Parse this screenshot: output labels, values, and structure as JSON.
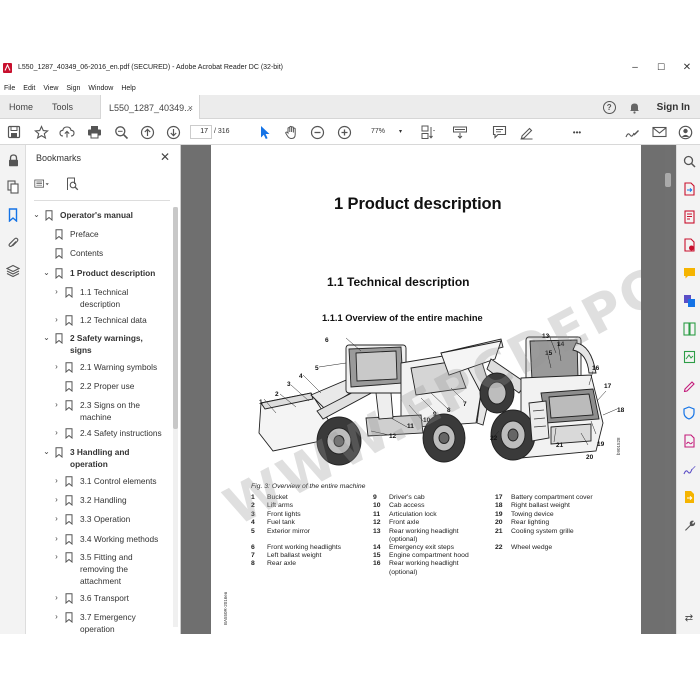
{
  "window": {
    "title": "L550_1287_40349_06-2016_en.pdf (SECURED) - Adobe Acrobat Reader DC (32-bit)",
    "minimize": "–",
    "maximize": "☐",
    "close": "✕"
  },
  "menu": [
    "File",
    "Edit",
    "View",
    "Sign",
    "Window",
    "Help"
  ],
  "tabs": {
    "home": "Home",
    "tools": "Tools",
    "doc": "L550_1287_40349...",
    "doc_close": "×",
    "signin": "Sign In",
    "help": "?"
  },
  "toolbar": {
    "page_current": "17",
    "page_total": "/ 316",
    "zoom": "77%",
    "zoom_caret": "▾",
    "more": "•••"
  },
  "bookmarks": {
    "header": "Bookmarks",
    "close": "✕",
    "items": [
      {
        "label": "Operator's manual",
        "level": 0,
        "chev": "⌄",
        "bold": true
      },
      {
        "label": "Preface",
        "level": 1,
        "chev": "",
        "bold": false
      },
      {
        "label": "Contents",
        "level": 1,
        "chev": "",
        "bold": false
      },
      {
        "label": "1 Product description",
        "level": 1,
        "chev": "⌄",
        "bold": true
      },
      {
        "label": "1.1 Technical description",
        "level": 2,
        "chev": "›",
        "bold": false
      },
      {
        "label": "1.2 Technical data",
        "level": 2,
        "chev": "›",
        "bold": false
      },
      {
        "label": "2 Safety warnings, signs",
        "level": 1,
        "chev": "⌄",
        "bold": true
      },
      {
        "label": "2.1 Warning symbols",
        "level": 2,
        "chev": "›",
        "bold": false
      },
      {
        "label": "2.2 Proper use",
        "level": 2,
        "chev": "",
        "bold": false
      },
      {
        "label": "2.3 Signs on the machine",
        "level": 2,
        "chev": "›",
        "bold": false
      },
      {
        "label": "2.4 Safety instructions",
        "level": 2,
        "chev": "›",
        "bold": false
      },
      {
        "label": "3 Handling and operation",
        "level": 1,
        "chev": "⌄",
        "bold": true
      },
      {
        "label": "3.1 Control elements",
        "level": 2,
        "chev": "›",
        "bold": false
      },
      {
        "label": "3.2 Handling",
        "level": 2,
        "chev": "›",
        "bold": false
      },
      {
        "label": "3.3 Operation",
        "level": 2,
        "chev": "›",
        "bold": false
      },
      {
        "label": "3.4 Working methods",
        "level": 2,
        "chev": "›",
        "bold": false
      },
      {
        "label": "3.5 Fitting and removing the attachment",
        "level": 2,
        "chev": "›",
        "bold": false
      },
      {
        "label": "3.6 Transport",
        "level": 2,
        "chev": "›",
        "bold": false
      },
      {
        "label": "3.7 Emergency operation",
        "level": 2,
        "chev": "›",
        "bold": false
      }
    ]
  },
  "document": {
    "h1": "1  Product description",
    "h2": "1.1  Technical description",
    "h3": "1.1.1   Overview of the entire machine",
    "figure_caption": "Fig. 3: Overview of the entire machine",
    "figure_code": "b901528",
    "side_code": "BA550R-2016en",
    "watermark": "WWW.EPCDEPO.COM",
    "legend": [
      {
        "n": "1",
        "t": "Bucket"
      },
      {
        "n": "2",
        "t": "Lift arms"
      },
      {
        "n": "3",
        "t": "Front lights"
      },
      {
        "n": "4",
        "t": "Fuel tank"
      },
      {
        "n": "5",
        "t": "Exterior mirror"
      },
      {
        "n": "6",
        "t": "Front working headlights"
      },
      {
        "n": "7",
        "t": "Left ballast weight"
      },
      {
        "n": "8",
        "t": "Rear axle"
      },
      {
        "n": "9",
        "t": "Driver's cab"
      },
      {
        "n": "10",
        "t": "Cab access"
      },
      {
        "n": "11",
        "t": "Articulation lock"
      },
      {
        "n": "12",
        "t": "Front axle"
      },
      {
        "n": "13",
        "t": "Rear working headlight (optional)"
      },
      {
        "n": "14",
        "t": "Emergency exit steps"
      },
      {
        "n": "15",
        "t": "Engine compartment hood"
      },
      {
        "n": "16",
        "t": "Rear working headlight (optional)"
      },
      {
        "n": "17",
        "t": "Battery compartment cover"
      },
      {
        "n": "18",
        "t": "Right ballast weight"
      },
      {
        "n": "19",
        "t": "Towing device"
      },
      {
        "n": "20",
        "t": "Rear lighting"
      },
      {
        "n": "21",
        "t": "Cooling system grille"
      },
      {
        "n": "22",
        "t": "Wheel wedge"
      }
    ],
    "callouts": [
      "1",
      "2",
      "3",
      "4",
      "5",
      "6",
      "7",
      "8",
      "9",
      "10",
      "11",
      "12",
      "13",
      "14",
      "15",
      "16",
      "17",
      "18",
      "19",
      "20",
      "21",
      "22"
    ]
  }
}
